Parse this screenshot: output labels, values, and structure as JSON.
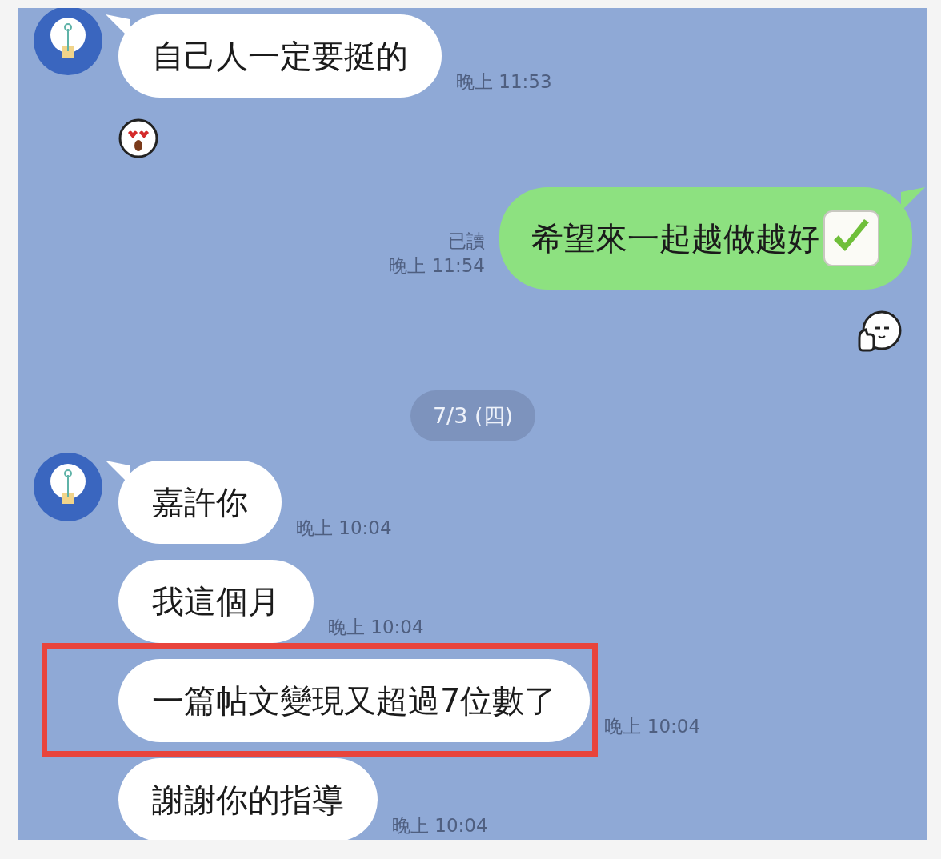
{
  "messages": [
    {
      "kind": "incoming",
      "avatar": true,
      "text": "自己人一定要挺的",
      "time": "晚上 11:53",
      "highlighted": false
    },
    {
      "kind": "incoming-sticker"
    },
    {
      "kind": "outgoing",
      "read": "已讀",
      "text": "希望來一起越做越好",
      "time": "晚上 11:54"
    },
    {
      "kind": "outgoing-sticker"
    },
    {
      "kind": "date",
      "text": "7/3 (四)"
    },
    {
      "kind": "incoming",
      "avatar": true,
      "text": "嘉許你",
      "time": "晚上 10:04",
      "highlighted": false
    },
    {
      "kind": "incoming",
      "avatar": false,
      "text": "我這個月",
      "time": "晚上 10:04",
      "highlighted": false
    },
    {
      "kind": "incoming",
      "avatar": false,
      "text": "一篇帖文變現又超過7位數了",
      "time": "晚上 10:04",
      "highlighted": true
    },
    {
      "kind": "incoming",
      "avatar": false,
      "text": "謝謝你的指導",
      "time": "晚上 10:04",
      "highlighted": false
    }
  ]
}
